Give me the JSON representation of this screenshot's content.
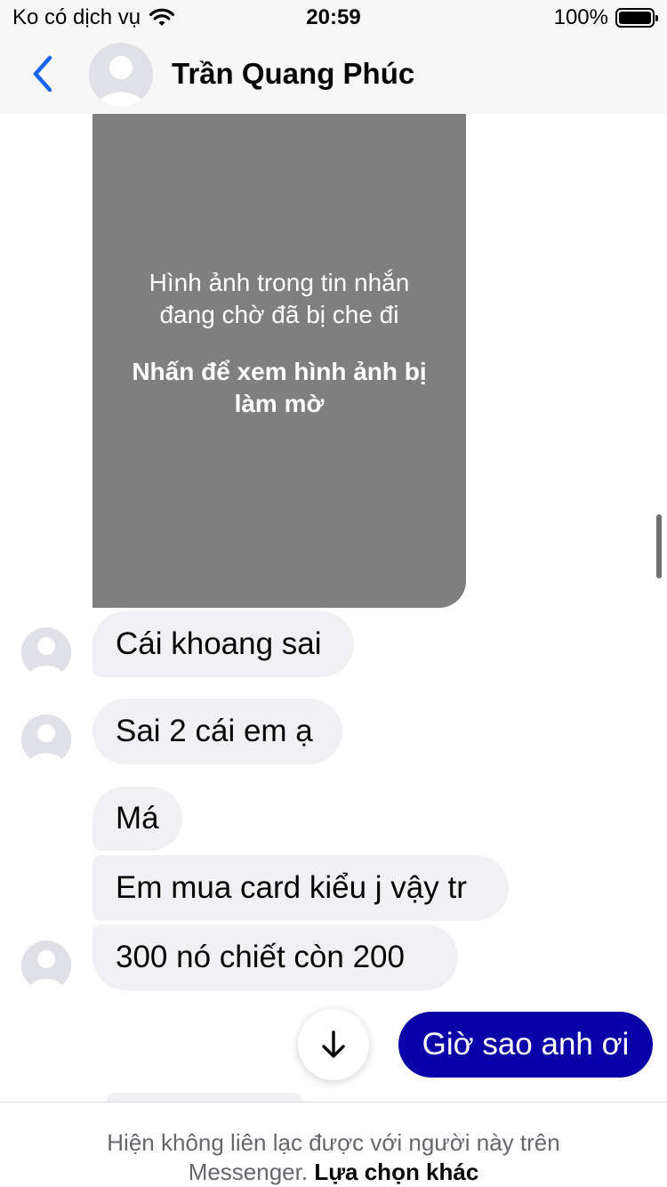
{
  "status_bar": {
    "carrier": "Ko có dịch vụ",
    "time": "20:59",
    "battery": "100%"
  },
  "header": {
    "contact_name": "Trần Quang Phúc"
  },
  "blurred_image": {
    "hidden_text": [
      "Hình ảnh trong tin nhắn",
      "đang chờ đã bị che đi"
    ],
    "tap_text": [
      "Nhấn để xem hình ảnh bị",
      "làm mờ"
    ]
  },
  "messages": [
    "Cái khoang sai",
    "Sai 2 cái em ạ",
    "Má",
    "Em mua card kiểu j vậy tr",
    "300 nó chiết còn 200"
  ],
  "sent_message": "Giờ sao anh ơi",
  "footer": {
    "notice": "Hiện không liên lạc được với người này trên",
    "notice_end": "Messenger.",
    "options_link": "Lựa chọn khác"
  },
  "colors": {
    "accent_blue": "#1a63f0",
    "sent_bubble": "#0a00a8",
    "received_bubble": "#f1f1f4",
    "blurred_image": "#7f7f7f"
  },
  "icons": [
    "wifi-icon",
    "battery-icon",
    "back-chevron-icon",
    "avatar-placeholder-icon",
    "arrow-down-icon"
  ]
}
